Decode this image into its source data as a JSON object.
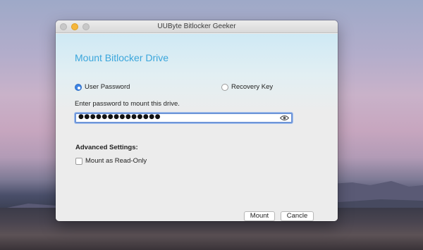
{
  "window": {
    "title": "UUByte Bitlocker Geeker"
  },
  "main": {
    "heading": "Mount Bitlocker Drive",
    "auth_options": [
      {
        "label": "User Password",
        "selected": true
      },
      {
        "label": "Recovery Key",
        "selected": false
      }
    ],
    "hint": "Enter password to mount this drive.",
    "password": {
      "masked_value": "●●●●●●●●●●●●●●",
      "reveal_icon": "eye-icon"
    },
    "advanced": {
      "title": "Advanced Settings:",
      "read_only_label": "Mount as Read-Only",
      "read_only_checked": false
    },
    "buttons": {
      "mount": "Mount",
      "cancel": "Cancle"
    }
  },
  "colors": {
    "accent": "#3aa6dc",
    "radio_selected": "#3d84e4",
    "focus_ring": "#6e95d8",
    "minimize_dot": "#f6b73c"
  }
}
